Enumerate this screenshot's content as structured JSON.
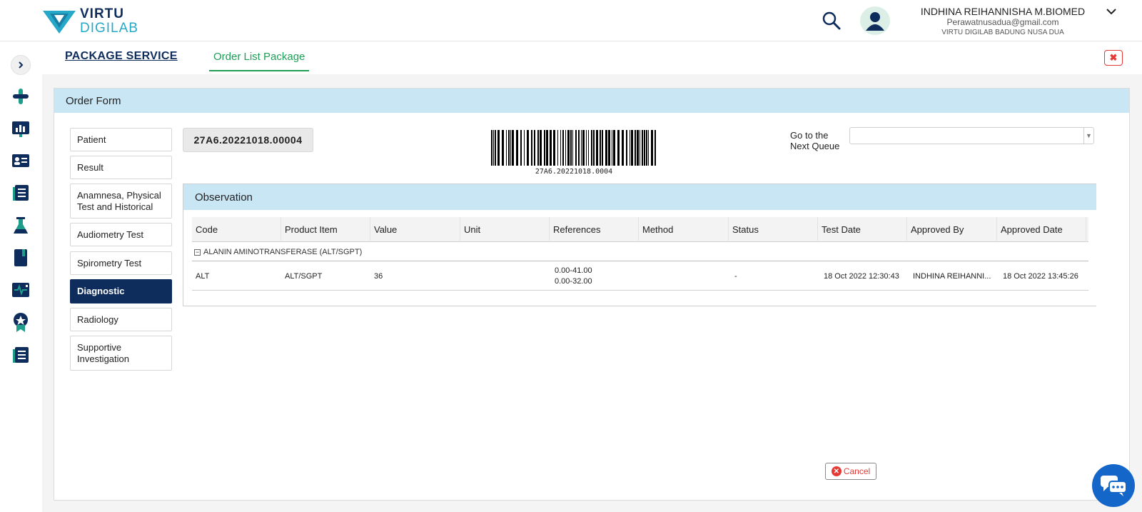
{
  "brand": {
    "line1": "VIRTU",
    "line2": "DIGILAB"
  },
  "user": {
    "name": "INDHINA REIHANNISHA M.BIOMED",
    "email": "Perawatnusadua@gmail.com",
    "branch": "VIRTU DIGILAB BADUNG NUSA DUA"
  },
  "sidebar": {
    "icons": [
      "expand-icon",
      "health-cross-icon",
      "dashboard-chart-icon",
      "id-card-icon",
      "records-book-icon",
      "flask-icon",
      "notebook-icon",
      "monitor-pulse-icon",
      "award-badge-icon",
      "report-book-icon"
    ]
  },
  "tabs": {
    "package": "PACKAGE SERVICE",
    "order": "Order List Package"
  },
  "form": {
    "title": "Order Form",
    "nav": [
      "Patient",
      "Result",
      "Anamnesa, Physical Test and Historical",
      "Audiometry Test",
      "Spirometry Test",
      "Diagnostic",
      "Radiology",
      "Supportive Investigation"
    ],
    "active_nav": "Diagnostic",
    "order_number": "27A6.20221018.00004",
    "barcode_text": "27A6.20221018.0004",
    "queue_label": "Go to the Next Queue",
    "queue_value": "",
    "cancel": "Cancel"
  },
  "observation": {
    "title": "Observation",
    "columns": [
      "Code",
      "Product Item",
      "Value",
      "Unit",
      "References",
      "Method",
      "Status",
      "Test Date",
      "Approved By",
      "Approved Date"
    ],
    "group": "ALANIN AMINOTRANSFERASE (ALT/SGPT)",
    "rows": [
      {
        "code": "ALT",
        "product_item": "ALT/SGPT",
        "value": "36",
        "unit": "",
        "references": [
          "0.00-41.00",
          "0.00-32.00"
        ],
        "method": "",
        "status": "-",
        "test_date": "18 Oct 2022 12:30:43",
        "approved_by": "INDHINA REIHANNI...",
        "approved_date": "18 Oct 2022 13:45:26"
      }
    ]
  },
  "colors": {
    "navy": "#0f2d5c",
    "green": "#1e9e57",
    "light_blue": "#c9e6f5",
    "red": "#e53935",
    "chat_blue": "#1466c8"
  }
}
